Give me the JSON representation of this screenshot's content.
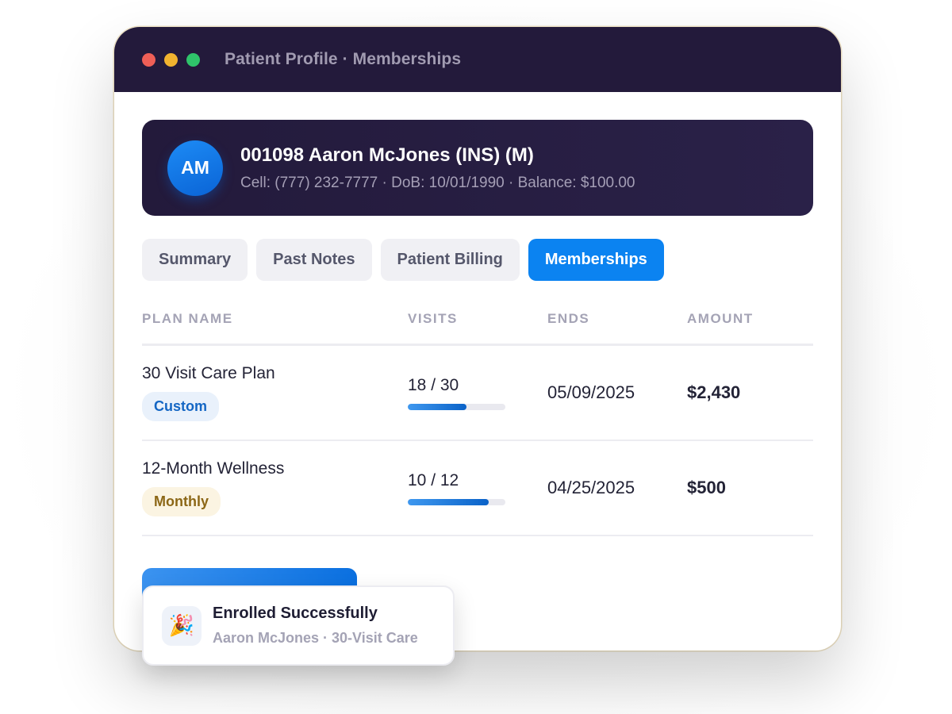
{
  "window": {
    "title": "Patient Profile · Memberships",
    "controls": [
      "close",
      "minimize",
      "maximize"
    ]
  },
  "patient": {
    "initials": "AM",
    "name": "001098 Aaron McJones (INS) (M)",
    "meta": "Cell: (777) 232-7777 · DoB: 10/01/1990 · Balance: $100.00"
  },
  "tabs": [
    {
      "label": "Summary",
      "active": false
    },
    {
      "label": "Past Notes",
      "active": false
    },
    {
      "label": "Patient Billing",
      "active": false
    },
    {
      "label": "Memberships",
      "active": true
    }
  ],
  "table": {
    "headers": {
      "plan": "PLAN NAME",
      "visits": "VISITS",
      "ends": "ENDS",
      "amount": "AMOUNT"
    },
    "rows": [
      {
        "plan": "30 Visit Care Plan",
        "badge": "Custom",
        "visits": "18 / 30",
        "visits_progress": 0.6,
        "ends": "05/09/2025",
        "amount": "$2,430"
      },
      {
        "plan": "12-Month Wellness",
        "badge": "Monthly",
        "visits": "10 / 12",
        "visits_progress": 0.8333,
        "ends": "04/25/2025",
        "amount": "$500"
      }
    ]
  },
  "toast": {
    "icon": "party-popper-icon",
    "title": "Enrolled Successfully",
    "subtitle": "Aaron McJones · 30-Visit Care"
  },
  "colors": {
    "titlebar": "#231a3b",
    "accent": "#0b83f1",
    "custom_badge": "#1466c4",
    "monthly_badge": "#8c6716"
  }
}
